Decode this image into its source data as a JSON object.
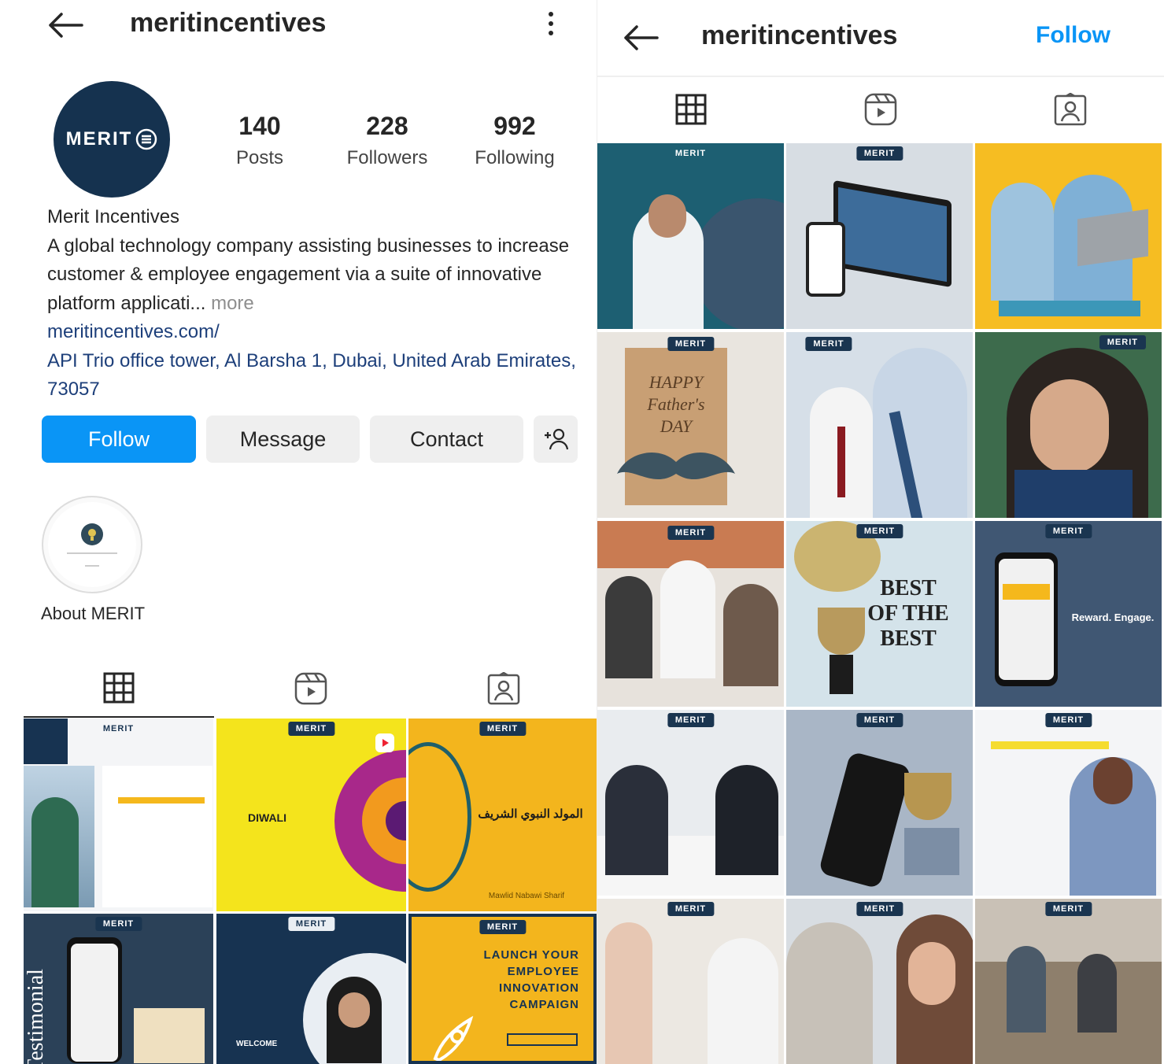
{
  "left": {
    "header": {
      "title": "meritincentives"
    },
    "profile": {
      "avatar_text": "MERIT",
      "stats": [
        {
          "count": "140",
          "label": "Posts"
        },
        {
          "count": "228",
          "label": "Followers"
        },
        {
          "count": "992",
          "label": "Following"
        }
      ],
      "name": "Merit Incentives",
      "bio_text": "A global technology company assisting businesses to increase customer & employee engagement via a suite of innovative platform applicati...",
      "bio_more": "more",
      "website": "meritincentives.com/",
      "address": "API Trio office tower, Al Barsha 1, Dubai, United Arab Emirates, 73057"
    },
    "buttons": {
      "follow": "Follow",
      "message": "Message",
      "contact": "Contact"
    },
    "highlight": {
      "label": "About MERIT"
    },
    "grid": [
      {
        "badge": "MERIT"
      },
      {
        "badge": "MERIT",
        "text": "DIWALI"
      },
      {
        "badge": "MERIT",
        "text": "المولد النبوي الشريف",
        "sub": "Mawlid Nabawi Sharif"
      },
      {
        "badge": "MERIT",
        "text": "Testimonial"
      },
      {
        "badge": "MERIT",
        "text": "WELCOME"
      },
      {
        "badge": "MERIT",
        "text": "LAUNCH YOUR EMPLOYEE INNOVATION CAMPAIGN"
      }
    ]
  },
  "right": {
    "header": {
      "title": "meritincentives",
      "follow": "Follow"
    },
    "grid": [
      {
        "badge": "MERIT"
      },
      {
        "badge": "MERIT"
      },
      {
        "badge": ""
      },
      {
        "badge": "MERIT",
        "text": "HAPPY Father's DAY"
      },
      {
        "badge": "MERIT"
      },
      {
        "badge": "MERIT"
      },
      {
        "badge": "MERIT"
      },
      {
        "badge": "MERIT",
        "text": "BEST OF THE BEST"
      },
      {
        "badge": "MERIT",
        "text": "Reward. Engage."
      },
      {
        "badge": "MERIT"
      },
      {
        "badge": "MERIT"
      },
      {
        "badge": "MERIT"
      },
      {
        "badge": "MERIT"
      },
      {
        "badge": "MERIT"
      },
      {
        "badge": "MERIT"
      }
    ]
  },
  "colors": {
    "accent": "#0a95f6",
    "navy": "#14304a",
    "yellow": "#f5b81c"
  }
}
